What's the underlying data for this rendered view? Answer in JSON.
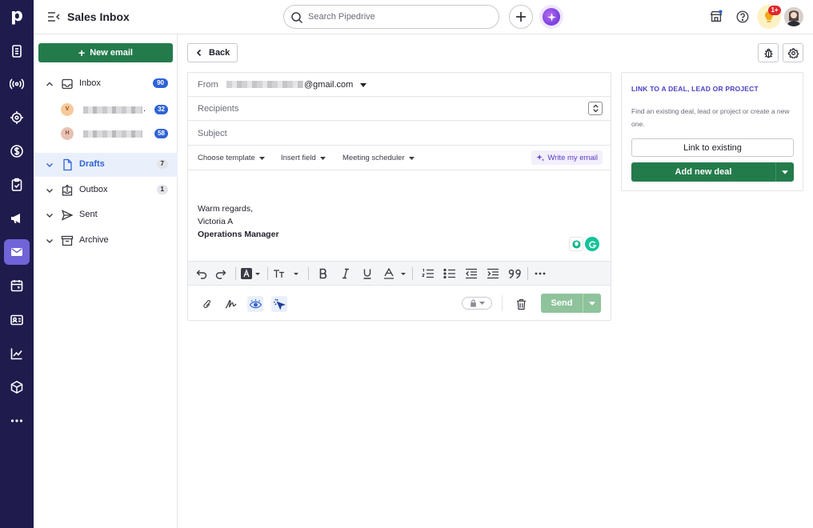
{
  "topbar": {
    "title": "Sales Inbox",
    "search_placeholder": "Search Pipedrive",
    "notification_badge": "1+"
  },
  "sidebar": {
    "new_email_label": "New email",
    "folders": [
      {
        "label": "Inbox",
        "count": "90"
      },
      {
        "label": "Drafts",
        "count": "7"
      },
      {
        "label": "Outbox",
        "count": "1"
      },
      {
        "label": "Sent",
        "count": ""
      },
      {
        "label": "Archive",
        "count": ""
      }
    ],
    "accounts": [
      {
        "initial": "V",
        "suffix": ".",
        "count": "32",
        "avatar_color": "#f7c99a"
      },
      {
        "initial": "H",
        "suffix": "",
        "count": "58",
        "avatar_color": "#e6c2b4"
      }
    ]
  },
  "main": {
    "back_label": "Back"
  },
  "composer": {
    "from_label": "From",
    "from_domain": "@gmail.com",
    "recipients_label": "Recipients",
    "subject_label": "Subject",
    "template_label": "Choose template",
    "insert_field_label": "Insert field",
    "meeting_label": "Meeting scheduler",
    "write_ai_label": "Write my email",
    "signature": {
      "closing": "Warm regards,",
      "name": "Victoria A",
      "title": "Operations Manager"
    },
    "send_label": "Send"
  },
  "link_panel": {
    "title": "LINK TO A DEAL, LEAD OR PROJECT",
    "description": "Find an existing deal, lead or project or create a new one.",
    "link_existing_label": "Link to existing",
    "add_deal_label": "Add new deal"
  },
  "colors": {
    "rail": "#1f1b4d",
    "rail_active": "#7064d8",
    "primary_green": "#237b4b",
    "disabled_green": "#8fc39b",
    "link_blue": "#2f63d6",
    "panel_title_purple": "#4a3fc4"
  }
}
